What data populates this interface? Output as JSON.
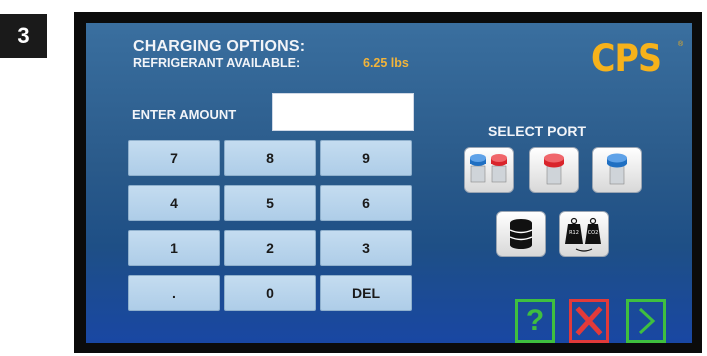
{
  "step_number": "3",
  "header": {
    "title": "CHARGING OPTIONS:",
    "refrigerant_label": "REFRIGERANT AVAILABLE:",
    "refrigerant_value": "6.25 lbs"
  },
  "brand": {
    "logo_text": "CPS",
    "logo_mark": "®"
  },
  "amount": {
    "label": "ENTER AMOUNT",
    "value": ""
  },
  "keypad": {
    "keys": [
      "7",
      "8",
      "9",
      "4",
      "5",
      "6",
      "1",
      "2",
      "3",
      ".",
      "0",
      "DEL"
    ]
  },
  "ports": {
    "label": "SELECT PORT",
    "options": [
      {
        "icon": "dual-port-icon"
      },
      {
        "icon": "high-side-port-icon"
      },
      {
        "icon": "low-side-port-icon"
      },
      {
        "icon": "tank-icon"
      },
      {
        "icon": "scale-weights-icon",
        "text": [
          "R12",
          "CO2"
        ]
      }
    ]
  },
  "actions": {
    "help_label": "?",
    "cancel_icon": "x-icon",
    "next_icon": "chevron-right-icon"
  },
  "colors": {
    "accent_orange": "#f6b21b",
    "value_orange": "#f2b43a",
    "confirm_green": "#3fbf3f",
    "cancel_red": "#e23a3a",
    "port_red": "#d9242b",
    "port_blue": "#1f6fc2"
  }
}
